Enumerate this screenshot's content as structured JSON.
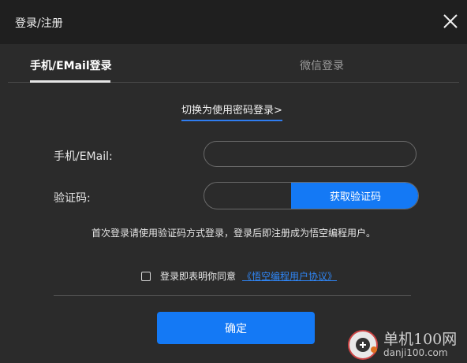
{
  "window": {
    "title": "登录/注册"
  },
  "tabs": [
    {
      "label": "手机/EMail登录",
      "active": true
    },
    {
      "label": "微信登录",
      "active": false
    }
  ],
  "switch_link": "切换为使用密码登录>",
  "form": {
    "phone_label": "手机/EMail:",
    "phone_value": "",
    "code_label": "验证码:",
    "code_value": "",
    "get_code_button": "获取验证码"
  },
  "hint": "首次登录请使用验证码方式登录，登录后即注册成为悟空编程用户。",
  "agreement": {
    "checked": false,
    "text": "登录即表明你同意",
    "link": "《悟空编程用户协议》"
  },
  "confirm_button": "确定",
  "watermark": {
    "main": "单机100网",
    "sub": "danji100.com"
  },
  "colors": {
    "accent": "#1479f5",
    "background": "#2b2b2b",
    "titlebar": "#1f1f1f"
  }
}
